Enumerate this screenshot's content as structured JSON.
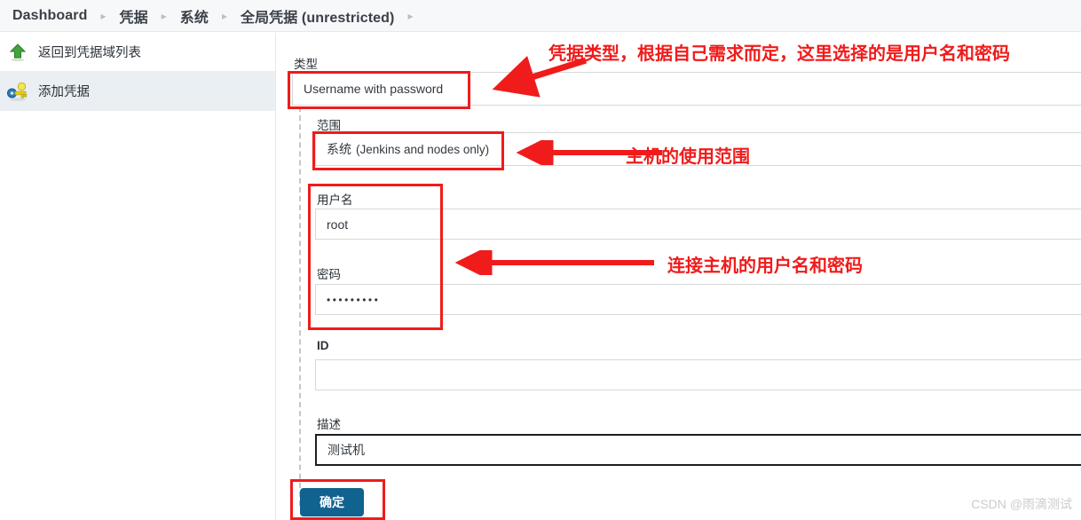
{
  "breadcrumb": {
    "items": [
      {
        "label": "Dashboard"
      },
      {
        "label": "凭据"
      },
      {
        "label": "系统"
      },
      {
        "label": "全局凭据 (unrestricted)"
      }
    ],
    "separator": "▸"
  },
  "sidebar": {
    "items": [
      {
        "label": "返回到凭据域列表",
        "icon": "green-up-arrow-icon",
        "active": false
      },
      {
        "label": "添加凭据",
        "icon": "key-add-icon",
        "active": true
      }
    ]
  },
  "form": {
    "type": {
      "label": "类型",
      "value": "Username with password"
    },
    "scope": {
      "label": "范围",
      "value_cn": "系统",
      "value_en": "(Jenkins and nodes only)"
    },
    "username": {
      "label": "用户名",
      "value": "root",
      "placeholder": ""
    },
    "password": {
      "label": "密码",
      "value": "•••••••••",
      "placeholder": ""
    },
    "id": {
      "label": "ID",
      "value": "",
      "placeholder": ""
    },
    "description": {
      "label": "描述",
      "value": "测试机",
      "placeholder": ""
    },
    "submit": {
      "label": "确定"
    }
  },
  "annotations": [
    {
      "text": "凭据类型，根据自己需求而定，这里选择的是用户名和密码"
    },
    {
      "text": "主机的使用范围"
    },
    {
      "text": "连接主机的用户名和密码"
    }
  ],
  "watermark": {
    "text": "CSDN @雨滴测试"
  },
  "colors": {
    "annotation_red": "#f01b1b",
    "button_blue": "#11638f",
    "breadcrumb_bg": "#f7f8f9",
    "sidebar_active_bg": "#eaeff4"
  }
}
